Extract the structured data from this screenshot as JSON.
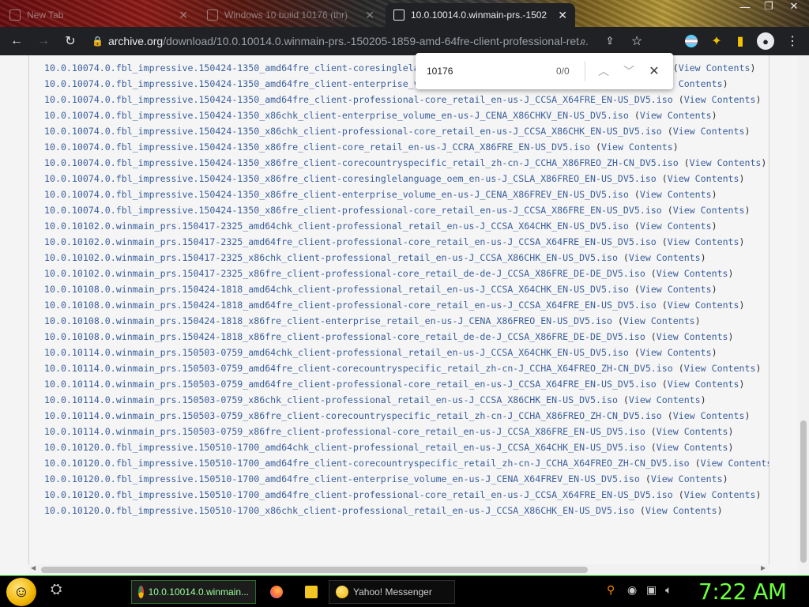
{
  "browser": {
    "tabs": [
      {
        "title": "New Tab",
        "active": false
      },
      {
        "title": "Windows 10 build 10176 (thr)",
        "active": false
      },
      {
        "title": "10.0.10014.0.winmain-prs.-15020",
        "active": true
      }
    ],
    "url_domain": "archive.org",
    "url_path": "/download/10.0.10014.0.winmain-prs.-150205-1859-amd-64fre-client-professional-ret..."
  },
  "find": {
    "query": "10176",
    "count": "0/0"
  },
  "listing": [
    {
      "file": "10.0.10074.0.fbl_impressive.150424-1350_amd64fre_client-coresinglelanguage_oem_en-us-J_CSLA_X64FREO_EN-US_DV5.iso",
      "link": "View Contents"
    },
    {
      "file": "10.0.10074.0.fbl_impressive.150424-1350_amd64fre_client-enterprise_volume_en-us-J_CENA_X64FREV_EN-US_DV5.iso",
      "link": "View Contents"
    },
    {
      "file": "10.0.10074.0.fbl_impressive.150424-1350_amd64fre_client-professional-core_retail_en-us-J_CCSA_X64FRE_EN-US_DV5.iso",
      "link": "View Contents"
    },
    {
      "file": "10.0.10074.0.fbl_impressive.150424-1350_x86chk_client-enterprise_volume_en-us-J_CENA_X86CHKV_EN-US_DV5.iso",
      "link": "View Contents"
    },
    {
      "file": "10.0.10074.0.fbl_impressive.150424-1350_x86chk_client-professional-core_retail_en-us-J_CCSA_X86CHK_EN-US_DV5.iso",
      "link": "View Contents"
    },
    {
      "file": "10.0.10074.0.fbl_impressive.150424-1350_x86fre_client-core_retail_en-us-J_CCRA_X86FRE_EN-US_DV5.iso",
      "link": "View Contents"
    },
    {
      "file": "10.0.10074.0.fbl_impressive.150424-1350_x86fre_client-corecountryspecific_retail_zh-cn-J_CCHA_X86FREO_ZH-CN_DV5.iso",
      "link": "View Contents"
    },
    {
      "file": "10.0.10074.0.fbl_impressive.150424-1350_x86fre_client-coresinglelanguage_oem_en-us-J_CSLA_X86FREO_EN-US_DV5.iso",
      "link": "View Contents"
    },
    {
      "file": "10.0.10074.0.fbl_impressive.150424-1350_x86fre_client-enterprise_volume_en-us-J_CENA_X86FREV_EN-US_DV5.iso",
      "link": "View Contents"
    },
    {
      "file": "10.0.10074.0.fbl_impressive.150424-1350_x86fre_client-professional-core_retail_en-us-J_CCSA_X86FRE_EN-US_DV5.iso",
      "link": "View Contents"
    },
    {
      "file": "10.0.10102.0.winmain_prs.150417-2325_amd64chk_client-professional_retail_en-us-J_CCSA_X64CHK_EN-US_DV5.iso",
      "link": "View Contents"
    },
    {
      "file": "10.0.10102.0.winmain_prs.150417-2325_amd64fre_client-professional-core_retail_en-us-J_CCSA_X64FRE_EN-US_DV5.iso",
      "link": "View Contents"
    },
    {
      "file": "10.0.10102.0.winmain_prs.150417-2325_x86chk_client-professional_retail_en-us-J_CCSA_X86CHK_EN-US_DV5.iso",
      "link": "View Contents"
    },
    {
      "file": "10.0.10102.0.winmain_prs.150417-2325_x86fre_client-professional-core_retail_de-de-J_CCSA_X86FRE_DE-DE_DV5.iso",
      "link": "View Contents"
    },
    {
      "file": "10.0.10108.0.winmain_prs.150424-1818_amd64chk_client-professional_retail_en-us-J_CCSA_X64CHK_EN-US_DV5.iso",
      "link": "View Contents"
    },
    {
      "file": "10.0.10108.0.winmain_prs.150424-1818_amd64fre_client-professional-core_retail_en-us-J_CCSA_X64FRE_EN-US_DV5.iso",
      "link": "View Contents"
    },
    {
      "file": "10.0.10108.0.winmain_prs.150424-1818_x86fre_client-enterprise_retail_en-us-J_CENA_X86FREO_EN-US_DV5.iso",
      "link": "View Contents"
    },
    {
      "file": "10.0.10108.0.winmain_prs.150424-1818_x86fre_client-professional-core_retail_de-de-J_CCSA_X86FRE_DE-DE_DV5.iso",
      "link": "View Contents"
    },
    {
      "file": "10.0.10114.0.winmain_prs.150503-0759_amd64chk_client-professional_retail_en-us-J_CCSA_X64CHK_EN-US_DV5.iso",
      "link": "View Contents"
    },
    {
      "file": "10.0.10114.0.winmain_prs.150503-0759_amd64fre_client-corecountryspecific_retail_zh-cn-J_CCHA_X64FREO_ZH-CN_DV5.iso",
      "link": "View Contents"
    },
    {
      "file": "10.0.10114.0.winmain_prs.150503-0759_amd64fre_client-professional-core_retail_en-us-J_CCSA_X64FRE_EN-US_DV5.iso",
      "link": "View Contents"
    },
    {
      "file": "10.0.10114.0.winmain_prs.150503-0759_x86chk_client-professional_retail_en-us-J_CCSA_X86CHK_EN-US_DV5.iso",
      "link": "View Contents"
    },
    {
      "file": "10.0.10114.0.winmain_prs.150503-0759_x86fre_client-corecountryspecific_retail_zh-cn-J_CCHA_X86FREO_ZH-CN_DV5.iso",
      "link": "View Contents"
    },
    {
      "file": "10.0.10114.0.winmain_prs.150503-0759_x86fre_client-professional-core_retail_en-us-J_CCSA_X86FRE_EN-US_DV5.iso",
      "link": "View Contents"
    },
    {
      "file": "10.0.10120.0.fbl_impressive.150510-1700_amd64chk_client-professional_retail_en-us-J_CCSA_X64CHK_EN-US_DV5.iso",
      "link": "View Contents"
    },
    {
      "file": "10.0.10120.0.fbl_impressive.150510-1700_amd64fre_client-corecountryspecific_retail_zh-cn-J_CCHA_X64FREO_ZH-CN_DV5.iso",
      "link": "View Contents"
    },
    {
      "file": "10.0.10120.0.fbl_impressive.150510-1700_amd64fre_client-enterprise_volume_en-us-J_CENA_X64FREV_EN-US_DV5.iso",
      "link": "View Contents"
    },
    {
      "file": "10.0.10120.0.fbl_impressive.150510-1700_amd64fre_client-professional-core_retail_en-us-J_CCSA_X64FRE_EN-US_DV5.iso",
      "link": "View Contents"
    },
    {
      "file": "10.0.10120.0.fbl_impressive.150510-1700_x86chk_client-professional_retail_en-us-J_CCSA_X86CHK_EN-US_DV5.iso",
      "link": "View Contents"
    }
  ],
  "taskbar": {
    "items": [
      {
        "label": "10.0.10014.0.winmain...",
        "icon": "chrome-icon",
        "active": true
      },
      {
        "label": "",
        "icon": "firefox-icon",
        "active": false
      },
      {
        "label": "",
        "icon": "folder-icon",
        "active": false
      },
      {
        "label": "Yahoo! Messenger",
        "icon": "yahoo-messenger-icon",
        "active": false
      }
    ],
    "clock": "7:22 AM"
  },
  "colors": {
    "link": "#3b5f9b",
    "clock": "#6cff3c",
    "tab_active_bg": "#202124"
  }
}
